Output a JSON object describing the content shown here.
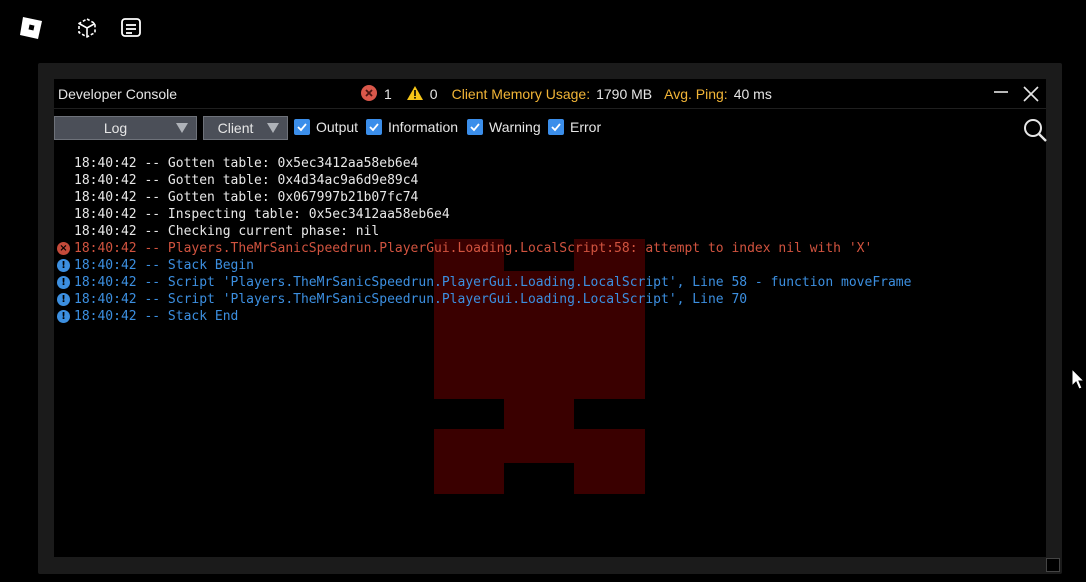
{
  "topbar": {
    "icons": [
      "roblox-logo-icon",
      "cube-icon",
      "chat-icon"
    ]
  },
  "console": {
    "title": "Developer Console",
    "error_count": "1",
    "warning_count": "0",
    "memory_label": "Client Memory Usage:",
    "memory_value": "1790 MB",
    "ping_label": "Avg. Ping:",
    "ping_value": "40 ms"
  },
  "toolbar": {
    "log_dropdown": "Log",
    "client_dropdown": "Client",
    "filters": [
      {
        "label": "Output",
        "checked": true
      },
      {
        "label": "Information",
        "checked": true
      },
      {
        "label": "Warning",
        "checked": true
      },
      {
        "label": "Error",
        "checked": true
      }
    ]
  },
  "log": [
    {
      "type": "output",
      "text": "18:40:42 -- Gotten table: 0x5ec3412aa58eb6e4"
    },
    {
      "type": "output",
      "text": "18:40:42 -- Gotten table: 0x4d34ac9a6d9e89c4"
    },
    {
      "type": "output",
      "text": "18:40:42 -- Gotten table: 0x067997b21b07fc74"
    },
    {
      "type": "output",
      "text": "18:40:42 -- Inspecting table: 0x5ec3412aa58eb6e4"
    },
    {
      "type": "output",
      "text": "18:40:42 -- Checking current phase: nil"
    },
    {
      "type": "error",
      "text": "18:40:42 -- Players.TheMrSanicSpeedrun.PlayerGui.Loading.LocalScript:58: attempt to index nil with 'X'"
    },
    {
      "type": "info",
      "text": "18:40:42 -- Stack Begin"
    },
    {
      "type": "info",
      "text": "18:40:42 -- Script 'Players.TheMrSanicSpeedrun.PlayerGui.Loading.LocalScript', Line 58 - function moveFrame"
    },
    {
      "type": "info",
      "text": "18:40:42 -- Script 'Players.TheMrSanicSpeedrun.PlayerGui.Loading.LocalScript', Line 70"
    },
    {
      "type": "info",
      "text": "18:40:42 -- Stack End"
    }
  ],
  "colors": {
    "accent_checkbox": "#3b8eea",
    "error_text": "#d1533f",
    "info_text": "#3c8fe0",
    "stat_label": "#f2b537",
    "watermark": "#3a0000"
  }
}
